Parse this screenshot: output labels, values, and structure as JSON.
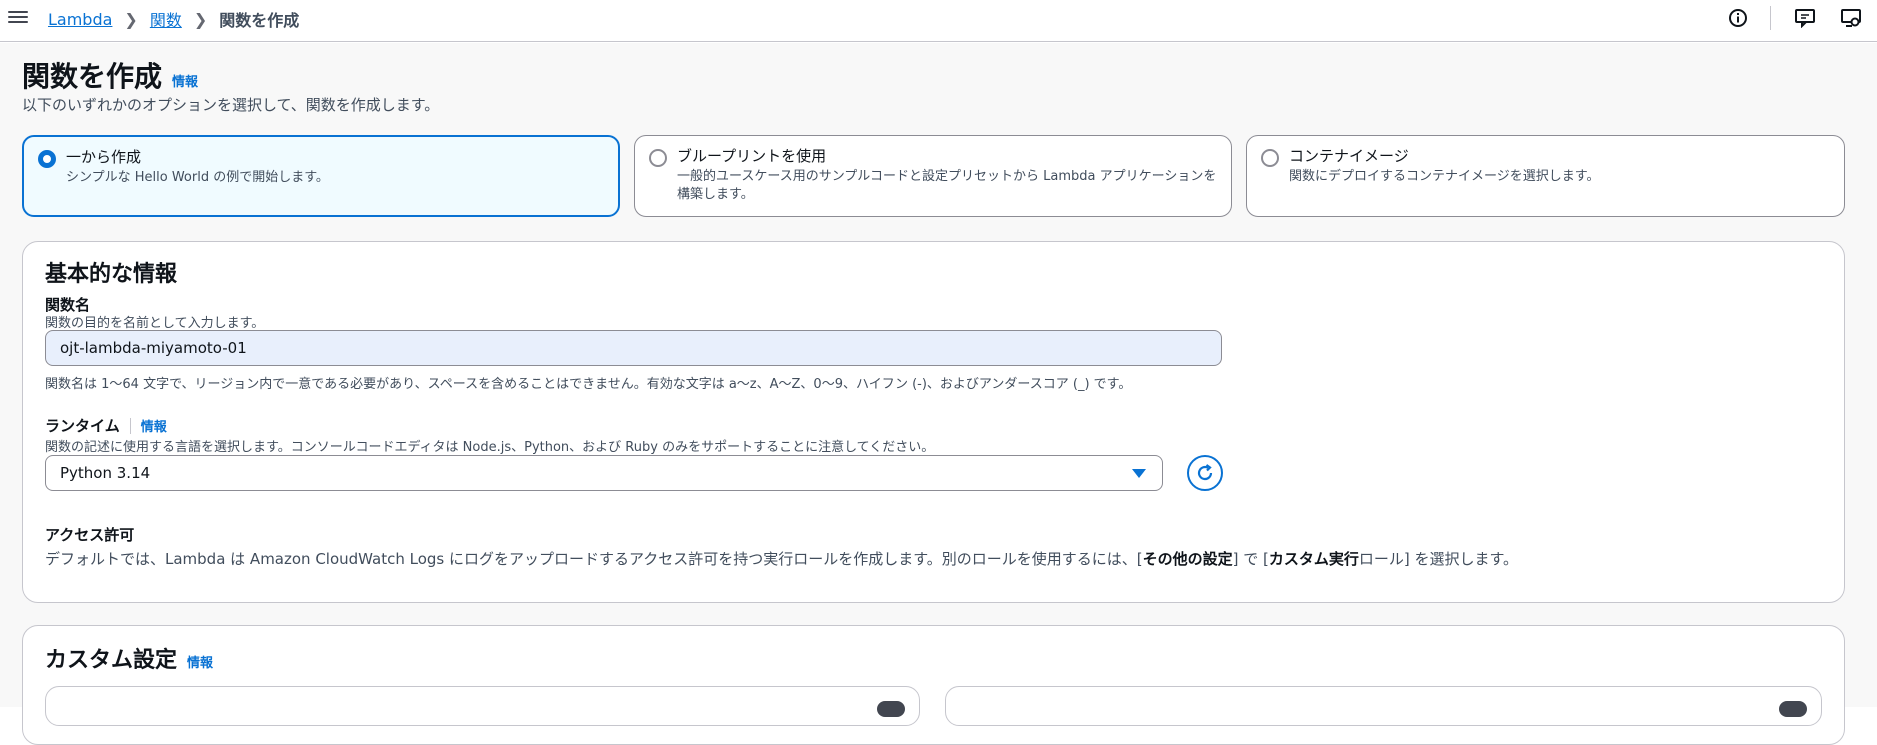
{
  "nav": {
    "menu_icon": "hamburger-icon",
    "breadcrumb": [
      {
        "label": "Lambda",
        "link": true
      },
      {
        "label": "関数",
        "link": true
      },
      {
        "label": "関数を作成",
        "link": false
      }
    ],
    "icons": [
      "info-icon",
      "feedback-icon",
      "settings-icon"
    ]
  },
  "header": {
    "title": "関数を作成",
    "info": "情報",
    "description": "以下のいずれかのオプションを選択して、関数を作成します。"
  },
  "options": [
    {
      "title": "一から作成",
      "desc": "シンプルな Hello World の例で開始します。",
      "selected": true
    },
    {
      "title": "ブループリントを使用",
      "desc": "一般的ユースケース用のサンプルコードと設定プリセットから Lambda アプリケーションを構築します。",
      "selected": false
    },
    {
      "title": "コンテナイメージ",
      "desc": "関数にデプロイするコンテナイメージを選択します。",
      "selected": false
    }
  ],
  "basic": {
    "heading": "基本的な情報",
    "fname_label": "関数名",
    "fname_desc": "関数の目的を名前として入力します。",
    "fname_value": "ojt-lambda-miyamoto-01",
    "fname_constraint": "関数名は 1〜64 文字で、リージョン内で一意である必要があり、スペースを含めることはできません。有効な文字は a〜z、A〜Z、0〜9、ハイフン (-)、およびアンダースコア (_) です。",
    "runtime_label": "ランタイム",
    "runtime_info": "情報",
    "runtime_desc": "関数の記述に使用する言語を選択します。コンソールコードエディタは Node.js、Python、および Ruby のみをサポートすることに注意してください。",
    "runtime_value": "Python 3.14",
    "perm_label": "アクセス許可",
    "perm_text_1": "デフォルトでは、Lambda は Amazon CloudWatch Logs にログをアップロードするアクセス許可を持つ実行ロールを作成します。別のロールを使用するには、[",
    "perm_bold_1": "その他の設定",
    "perm_text_2": "] で [",
    "perm_bold_2": "カスタム実行",
    "perm_text_3": "ロール] を選択します。"
  },
  "custom": {
    "heading": "カスタム設定",
    "info": "情報"
  }
}
